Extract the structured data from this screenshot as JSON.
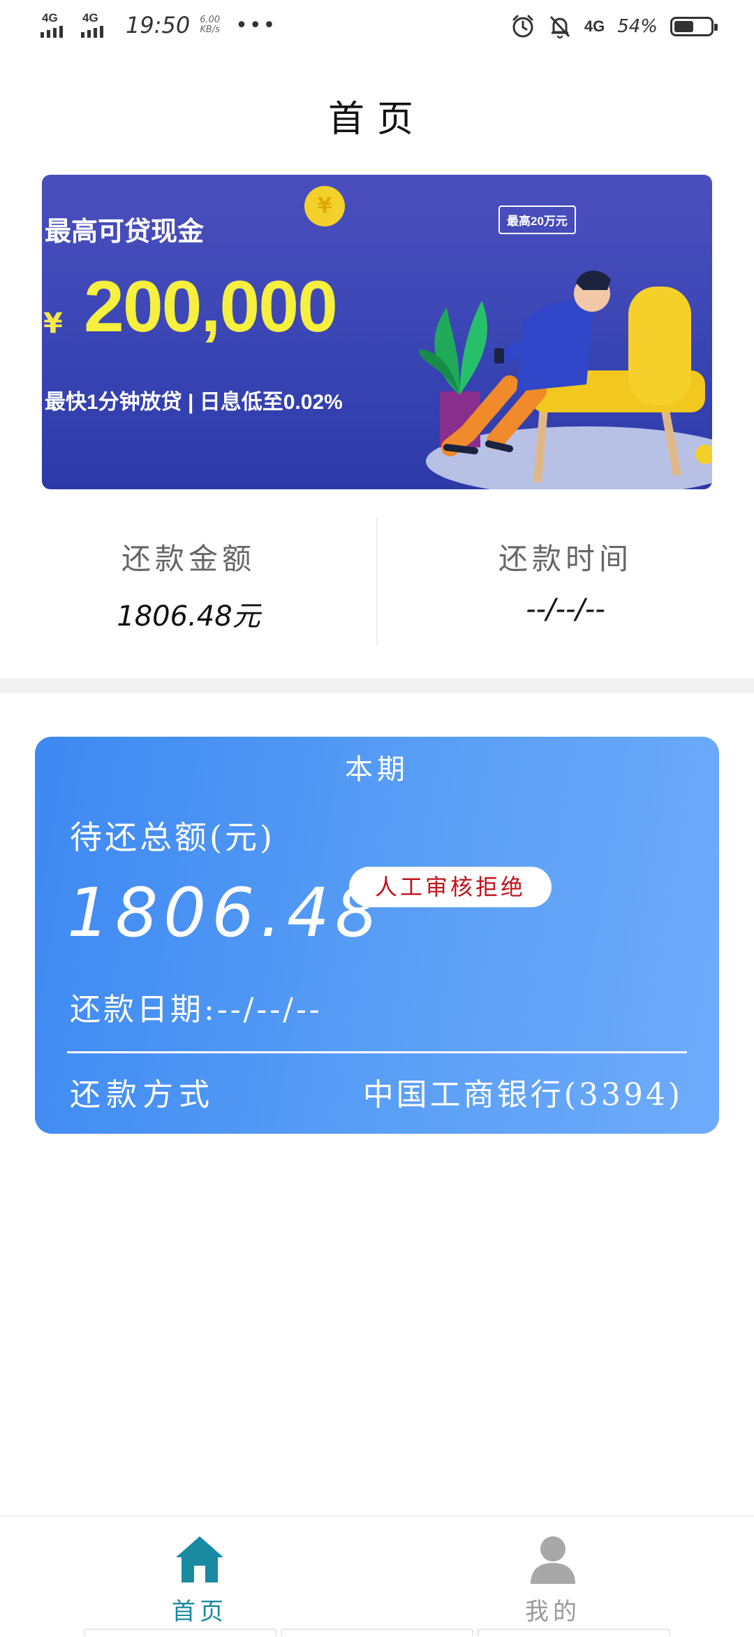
{
  "status_bar": {
    "signal1": "4G",
    "signal2": "4G",
    "time": "19:50",
    "speed_value": "6.00",
    "speed_unit": "KB/s",
    "more": "•••",
    "network": "4G",
    "battery_pct": "54%",
    "battery_level": 0.54
  },
  "header": {
    "title": "首页"
  },
  "banner": {
    "headline": "最高可贷现金",
    "currency": "¥",
    "amount": "200,000",
    "subline": "最快1分钟放贷 | 日息低至0.02%",
    "bubble": "最高20万元",
    "coin": "¥"
  },
  "summary": {
    "amount_label": "还款金额",
    "amount_value": "1806.48元",
    "time_label": "还款时间",
    "time_value": "--/--/--"
  },
  "card": {
    "period": "本期",
    "total_label": "待还总额(元)",
    "total_value": "1806.48",
    "status_badge": "人工审核拒绝",
    "date_text": "还款日期:--/--/--",
    "method_label": "还款方式",
    "method_value": "中国工商银行(3394)"
  },
  "bottom_nav": {
    "home_label": "首页",
    "mine_label": "我的",
    "active": "首页",
    "active_color": "#1a8aa2",
    "inactive_color": "#9a9a9a"
  },
  "colors": {
    "card_gradient_start": "#3d88f2",
    "card_gradient_end": "#6eabfb",
    "banner_bg": "#3a45b4",
    "badge_text": "#c0121a"
  }
}
